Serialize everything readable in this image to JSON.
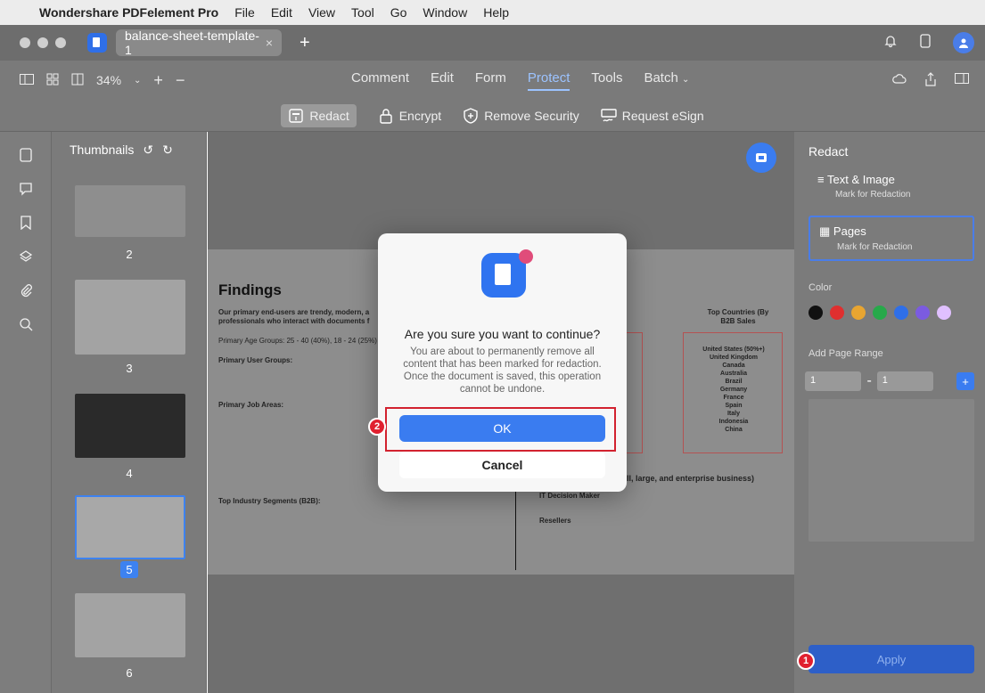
{
  "menubar": {
    "app": "Wondershare PDFelement Pro",
    "items": [
      "File",
      "Edit",
      "View",
      "Tool",
      "Go",
      "Window",
      "Help"
    ]
  },
  "tab": {
    "title": "balance-sheet-template-1",
    "close": "×",
    "plus": "+"
  },
  "toolbar": {
    "zoom": "34%",
    "tabs": [
      "Comment",
      "Edit",
      "Form",
      "Protect",
      "Tools",
      "Batch"
    ],
    "active_tab": "Protect"
  },
  "subbar": {
    "redact": "Redact",
    "encrypt": "Encrypt",
    "remove": "Remove Security",
    "esign": "Request eSign"
  },
  "thumbs": {
    "title": "Thumbnails",
    "pages": [
      "2",
      "3",
      "4",
      "5",
      "6"
    ],
    "selected": "5"
  },
  "page": {
    "heading": "Findings",
    "intro": "Our primary end-users are trendy, modern, a professionals who interact with documents f",
    "age": "Primary Age Groups: 25 - 40 (40%), 18 - 24 (25%)",
    "users_h": "Primary User Groups:",
    "job_h": "Primary Job Areas:",
    "seg_h": "Top Industry Segments (B2B):",
    "countries_h": "Top Countries (By B2B Sales",
    "countries": [
      "United States (50%+)",
      "United Kingdom",
      "Canada",
      "Australia",
      "Brazil",
      "Germany",
      "France",
      "Spain",
      "Italy",
      "Indonesia",
      "China"
    ],
    "enterprise": "ll, large, and enterprise business)",
    "it_h": "IT Decision Maker",
    "resellers_h": "Resellers"
  },
  "right": {
    "title": "Redact",
    "opt1": "Text & Image",
    "opt1_sub": "Mark for Redaction",
    "opt2": "Pages",
    "opt2_sub": "Mark for Redaction",
    "color_label": "Color",
    "colors": [
      "#111111",
      "#e02f2f",
      "#e8a531",
      "#27a94a",
      "#2f6fe8",
      "#7b5be0",
      "#e0c0ff"
    ],
    "range_label": "Add Page Range",
    "range_from": "1",
    "range_to": "1",
    "apply": "Apply"
  },
  "modal": {
    "title": "Are you sure you want to continue?",
    "body": "You are about to permanently remove all content that has been marked for redaction. Once the document is saved, this operation cannot be undone.",
    "ok": "OK",
    "cancel": "Cancel"
  },
  "steps": {
    "one": "1",
    "two": "2"
  }
}
